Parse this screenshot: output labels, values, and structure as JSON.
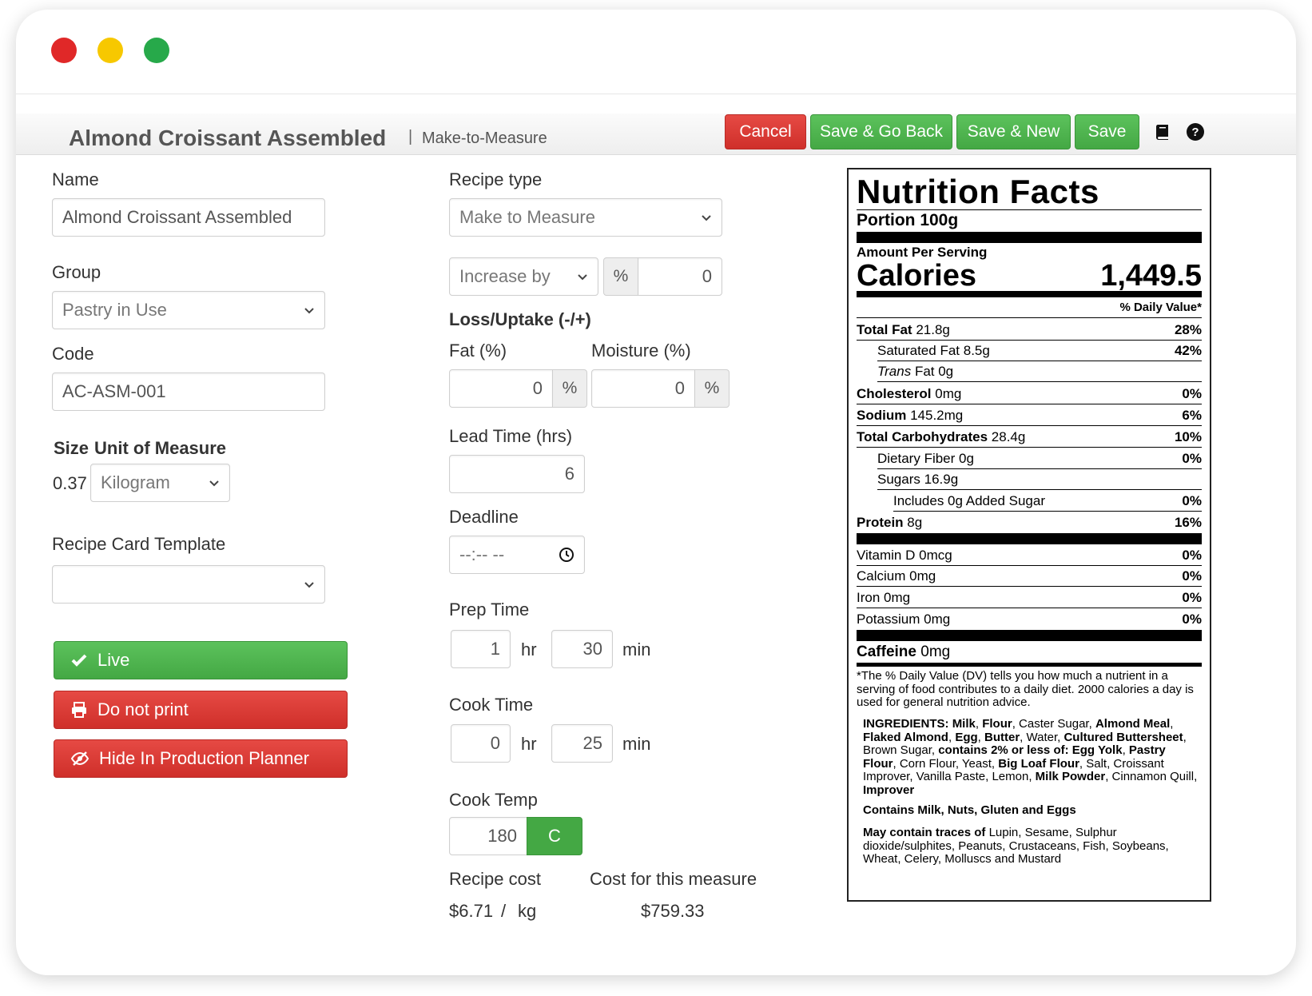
{
  "header": {
    "title": "Almond Croissant Assembled",
    "separator": "|",
    "subtitle": "Make-to-Measure",
    "buttons": {
      "cancel": "Cancel",
      "save_back": "Save & Go Back",
      "save_new": "Save & New",
      "save": "Save"
    },
    "icons": [
      "book-icon",
      "help-icon"
    ]
  },
  "form": {
    "name_label": "Name",
    "name_value": "Almond Croissant Assembled",
    "group_label": "Group",
    "group_value": "Pastry in Use",
    "code_label": "Code",
    "code_value": "AC-ASM-001",
    "size_label": "Size",
    "uom_label": "Unit of Measure",
    "size_value": "0.37",
    "uom_value": "Kilogram",
    "template_label": "Recipe Card Template",
    "template_value": "",
    "live_label": "Live",
    "print_label": "Do not print",
    "hide_label": "Hide In Production Planner",
    "recipe_type_label": "Recipe type",
    "recipe_type_value": "Make to Measure",
    "increase_value": "Increase by",
    "percent_sign": "%",
    "increase_amount": "0",
    "loss_label": "Loss/Uptake (-/+)",
    "fat_label": "Fat (%)",
    "fat_value": "0",
    "moisture_label": "Moisture (%)",
    "moisture_value": "0",
    "lead_label": "Lead Time (hrs)",
    "lead_value": "6",
    "deadline_label": "Deadline",
    "deadline_value": "--:-- --",
    "prep_label": "Prep Time",
    "prep_hr": "1",
    "prep_min": "30",
    "cook_label": "Cook Time",
    "cook_hr": "0",
    "cook_min": "25",
    "hr_unit": "hr",
    "min_unit": "min",
    "temp_label": "Cook Temp",
    "temp_value": "180",
    "temp_unit": "C",
    "cost_label": "Recipe cost",
    "cost_value": "$6.71",
    "cost_sep": "/",
    "cost_unit": "kg",
    "measure_cost_label": "Cost for this measure",
    "measure_cost_value": "$759.33"
  },
  "nutrition": {
    "title": "Nutrition Facts",
    "portion": "Portion 100g",
    "amount_per": "Amount Per Serving",
    "calories_label": "Calories",
    "calories_value": "1,449.5",
    "dv_header": "% Daily Value*",
    "rows": [
      {
        "name": "Total Fat",
        "amt": "21.8g",
        "dv": "28%"
      },
      {
        "name": "Saturated Fat",
        "amt": "8.5g",
        "dv": "42%"
      },
      {
        "name": "Trans",
        "amt": "Fat 0g",
        "dv": ""
      },
      {
        "name": "Cholesterol",
        "amt": "0mg",
        "dv": "0%"
      },
      {
        "name": "Sodium",
        "amt": "145.2mg",
        "dv": "6%"
      },
      {
        "name": "Total Carbohydrates",
        "amt": "28.4g",
        "dv": "10%"
      },
      {
        "name": "Dietary Fiber",
        "amt": "0g",
        "dv": "0%"
      },
      {
        "name": "Sugars",
        "amt": "16.9g",
        "dv": ""
      },
      {
        "name": "Includes 0g Added Sugar",
        "amt": "",
        "dv": "0%"
      },
      {
        "name": "Protein",
        "amt": "8g",
        "dv": "16%"
      },
      {
        "name": "Vitamin D",
        "amt": "0mcg",
        "dv": "0%"
      },
      {
        "name": "Calcium",
        "amt": "0mg",
        "dv": "0%"
      },
      {
        "name": "Iron",
        "amt": "0mg",
        "dv": "0%"
      },
      {
        "name": "Potassium",
        "amt": "0mg",
        "dv": "0%"
      },
      {
        "name": "Caffeine",
        "amt": "0mg",
        "dv": ""
      }
    ],
    "footnote": "*The % Daily Value (DV) tells you how much a nutrient in a serving of food contributes to a daily diet. 2000 calories a day is used for general nutrition advice.",
    "ingredients_label": "INGREDIENTS:",
    "ingredients": [
      {
        "t": "Milk",
        "b": true
      },
      {
        "t": ", ",
        "b": false
      },
      {
        "t": "Flour",
        "b": true
      },
      {
        "t": ", Caster Sugar, ",
        "b": false
      },
      {
        "t": "Almond Meal",
        "b": true
      },
      {
        "t": ", ",
        "b": false
      },
      {
        "t": "Flaked Almond",
        "b": true
      },
      {
        "t": ", ",
        "b": false
      },
      {
        "t": "Egg",
        "b": true
      },
      {
        "t": ", ",
        "b": false
      },
      {
        "t": "Butter",
        "b": true
      },
      {
        "t": ", Water, ",
        "b": false
      },
      {
        "t": "Cultured Buttersheet",
        "b": true
      },
      {
        "t": ", Brown Sugar, ",
        "b": false
      },
      {
        "t": "contains 2% or less of: Egg Yolk",
        "b": true
      },
      {
        "t": ", ",
        "b": false
      },
      {
        "t": "Pastry Flour",
        "b": true
      },
      {
        "t": ", Corn Flour, Yeast, ",
        "b": false
      },
      {
        "t": "Big Loaf Flour",
        "b": true
      },
      {
        "t": ", Salt, Croissant Improver, Vanilla Paste, Lemon, ",
        "b": false
      },
      {
        "t": "Milk Powder",
        "b": true
      },
      {
        "t": ", Cinnamon Quill, ",
        "b": false
      },
      {
        "t": "Improver",
        "b": true
      }
    ],
    "contains": "Contains Milk, Nuts, Gluten and Eggs",
    "may_contain_label": "May contain traces of",
    "may_contain": "Lupin, Sesame, Sulphur dioxide/sulphites, Peanuts, Crustaceans, Fish, Soybeans, Wheat, Celery, Molluscs and Mustard"
  },
  "colors": {
    "green": "#44a844",
    "red": "#cf2f2a",
    "window_red": "#e02828",
    "window_yellow": "#f7c800",
    "window_green": "#27a94a"
  }
}
